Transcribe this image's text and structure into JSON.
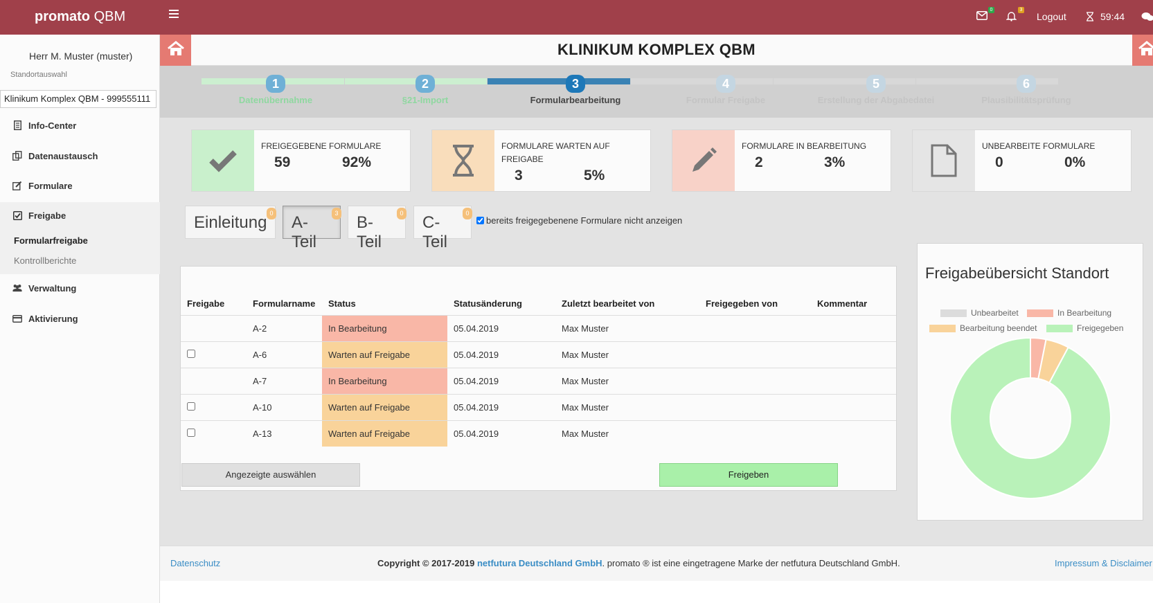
{
  "app": {
    "brand_bold": "promato",
    "brand_rest": "QBM"
  },
  "topbar": {
    "mail_count": "0",
    "notif_count": "3",
    "logout": "Logout",
    "timer": "59:44"
  },
  "sidebar": {
    "user": "Herr M. Muster (muster)",
    "standort_label": "Standortauswahl",
    "standort_value": "Klinikum Komplex QBM - 999555111",
    "items": [
      {
        "label": "Info-Center"
      },
      {
        "label": "Datenaustausch"
      },
      {
        "label": "Formulare"
      },
      {
        "label": "Freigabe"
      },
      {
        "label": "Verwaltung"
      },
      {
        "label": "Aktivierung"
      }
    ],
    "subitems": [
      {
        "label": "Formularfreigabe"
      },
      {
        "label": "Kontrollberichte"
      }
    ]
  },
  "page": {
    "title": "KLINIKUM KOMPLEX QBM"
  },
  "steps": [
    {
      "num": "1",
      "label": "Datenübernahme",
      "state": "done"
    },
    {
      "num": "2",
      "label": "§21-Import",
      "state": "done"
    },
    {
      "num": "3",
      "label": "Formularbearbeitung",
      "state": "active"
    },
    {
      "num": "4",
      "label": "Formular Freigabe",
      "state": "pending"
    },
    {
      "num": "5",
      "label": "Erstellung der Abgabedatei",
      "state": "pending"
    },
    {
      "num": "6",
      "label": "Plausibilitätsprüfung",
      "state": "pending"
    }
  ],
  "stats": [
    {
      "title": "Freigegebene Formulare",
      "count": "59",
      "percent": "92%"
    },
    {
      "title": "Formulare warten auf Freigabe",
      "count": "3",
      "percent": "5%"
    },
    {
      "title": "Formulare in Bearbeitung",
      "count": "2",
      "percent": "3%"
    },
    {
      "title": "Unbearbeite Formulare",
      "count": "0",
      "percent": "0%"
    }
  ],
  "tabs": [
    {
      "label": "Einleitung",
      "badge": "0"
    },
    {
      "label": "A-Teil",
      "badge": "3"
    },
    {
      "label": "B-Teil",
      "badge": "0"
    },
    {
      "label": "C-Teil",
      "badge": "0"
    }
  ],
  "filter": {
    "label": "bereits freigegebenene Formulare nicht anzeigen",
    "checked": true
  },
  "table": {
    "headers": [
      "Freigabe",
      "Formularname",
      "Status",
      "Statusänderung",
      "Zuletzt bearbeitet von",
      "Freigegeben von",
      "Kommentar"
    ],
    "rows": [
      {
        "checkbox": false,
        "name": "A-2",
        "status": "In Bearbeitung",
        "date": "05.04.2019",
        "editor": "Max Muster",
        "released_by": "",
        "comment": ""
      },
      {
        "checkbox": true,
        "name": "A-6",
        "status": "Warten auf Freigabe",
        "date": "05.04.2019",
        "editor": "Max Muster",
        "released_by": "",
        "comment": ""
      },
      {
        "checkbox": false,
        "name": "A-7",
        "status": "In Bearbeitung",
        "date": "05.04.2019",
        "editor": "Max Muster",
        "released_by": "",
        "comment": ""
      },
      {
        "checkbox": true,
        "name": "A-10",
        "status": "Warten auf Freigabe",
        "date": "05.04.2019",
        "editor": "Max Muster",
        "released_by": "",
        "comment": ""
      },
      {
        "checkbox": true,
        "name": "A-13",
        "status": "Warten auf Freigabe",
        "date": "05.04.2019",
        "editor": "Max Muster",
        "released_by": "",
        "comment": ""
      }
    ]
  },
  "buttons": {
    "select_shown": "Angezeigte auswählen",
    "release": "Freigeben"
  },
  "chart_data": {
    "type": "pie",
    "title": "Freigabeübersicht Standort",
    "categories": [
      "Unbearbeitet",
      "In Bearbeitung",
      "Bearbeitung beendet",
      "Freigegeben"
    ],
    "values": [
      0,
      2,
      3,
      59
    ],
    "colors": [
      "#dcdcdc",
      "#f9b7a7",
      "#f9d39a",
      "#b9f2b9"
    ],
    "legend": "top"
  },
  "footer": {
    "privacy": "Datenschutz",
    "copyright_prefix": "Copyright © 2017-2019 ",
    "company": "netfutura Deutschland GmbH",
    "copyright_suffix": ". promato ® ist eine eingetragene Marke der netfutura Deutschland GmbH.",
    "imprint": "Impressum & Disclaimer"
  }
}
